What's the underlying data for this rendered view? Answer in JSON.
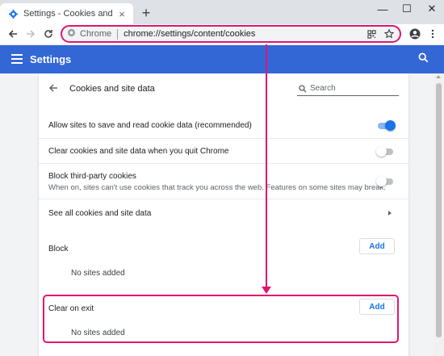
{
  "browser": {
    "tab_title": "Settings - Cookies and site data",
    "tab_close": "×",
    "new_tab": "+",
    "window_minimize": "—",
    "window_maximize": "☐",
    "window_close": "✕",
    "omnibox_site_label": "Chrome",
    "omnibox_url": "chrome://settings/content/cookies"
  },
  "appbar": {
    "title": "Settings"
  },
  "page": {
    "title": "Cookies and site data",
    "search_placeholder": "Search"
  },
  "settings": [
    {
      "label": "Allow sites to save and read cookie data (recommended)",
      "toggle": "on"
    },
    {
      "label": "Clear cookies and site data when you quit Chrome",
      "toggle": "off"
    },
    {
      "label": "Block third-party cookies",
      "sublabel": "When on, sites can't use cookies that track you across the web. Features on some sites may break.",
      "toggle": "off"
    },
    {
      "label": "See all cookies and site data"
    }
  ],
  "sections": {
    "block": {
      "label": "Block",
      "add_label": "Add",
      "empty_text": "No sites added"
    },
    "clear_on_exit": {
      "label": "Clear on exit",
      "add_label": "Add",
      "empty_text": "No sites added"
    }
  },
  "colors": {
    "accent": "#3367d6",
    "link": "#1a73e8",
    "annotation": "#e0166e"
  },
  "icons": [
    "settings-gear-icon",
    "back-icon",
    "forward-icon",
    "reload-icon",
    "site-info-icon",
    "qr-code-icon",
    "bookmark-star-icon",
    "profile-icon",
    "kebab-menu-icon",
    "hamburger-menu-icon",
    "search-icon",
    "arrow-left-icon",
    "chevron-right-icon"
  ]
}
